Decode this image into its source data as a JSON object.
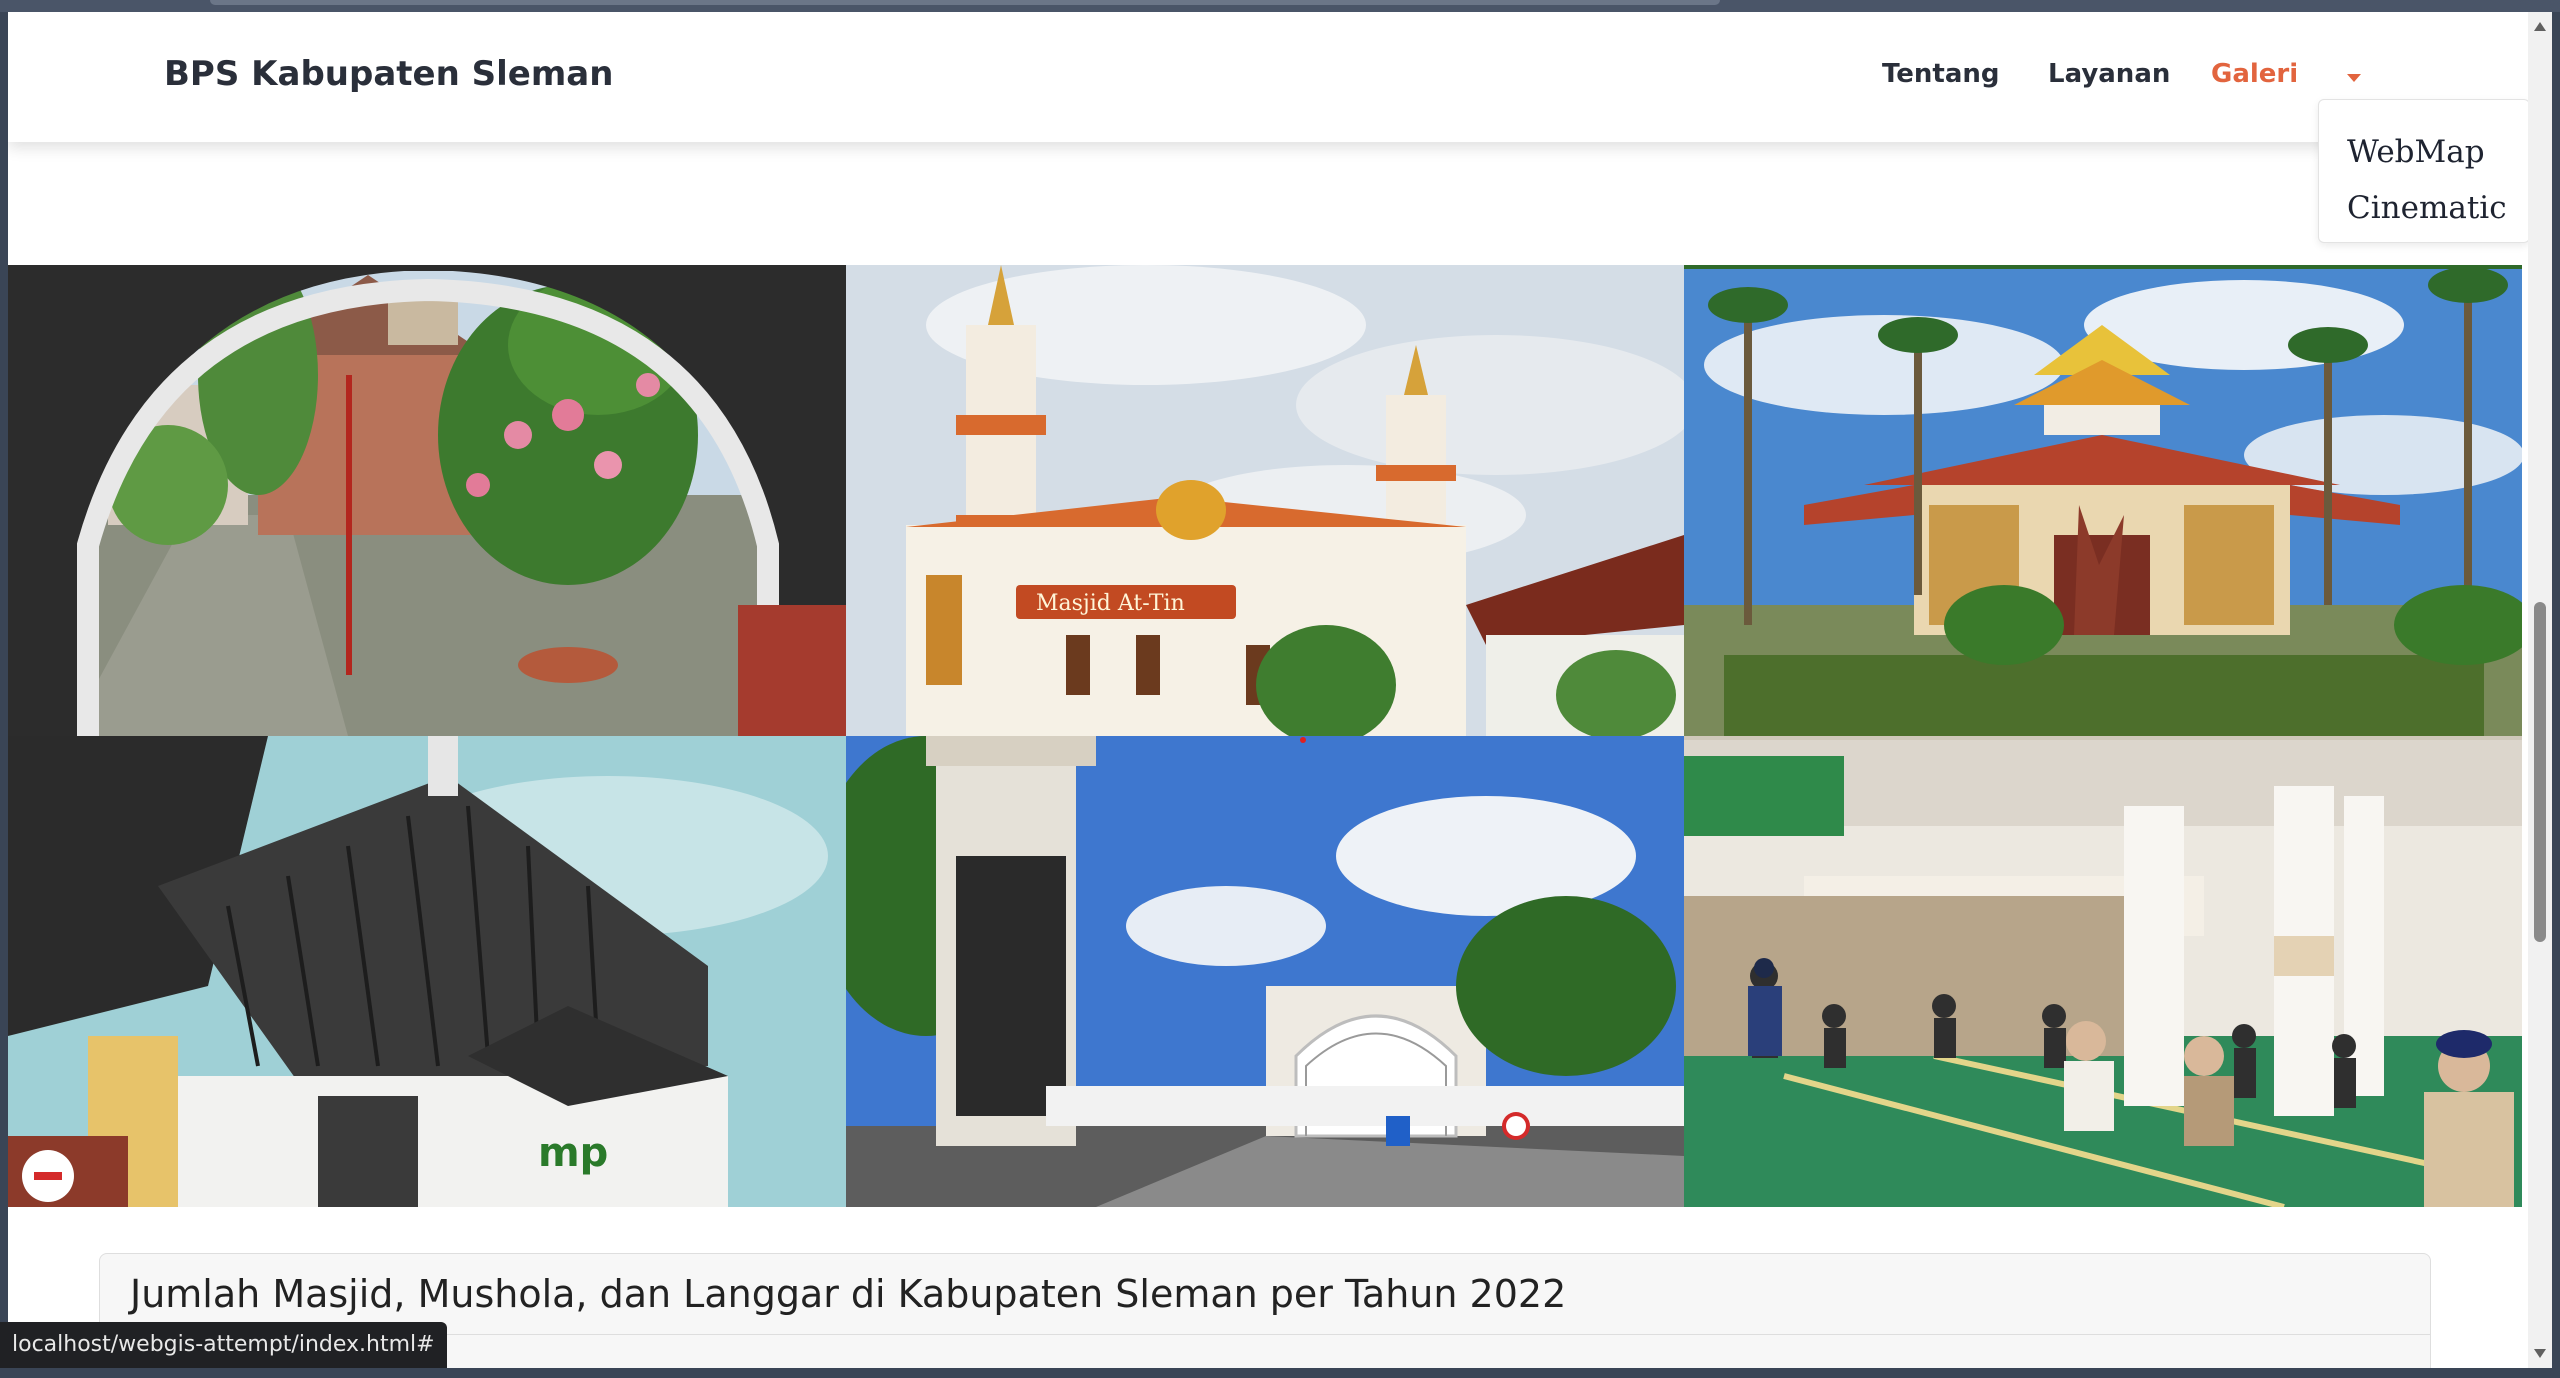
{
  "navbar": {
    "brand": "BPS Kabupaten Sleman",
    "links": [
      "Tentang",
      "Layanan",
      "Galeri"
    ],
    "active_link": "Galeri",
    "accent_color": "#e2643e"
  },
  "dropdown": {
    "items": [
      "WebMap",
      "Cinematic"
    ]
  },
  "gallery": {
    "sign_text": "Masjid At-Tin",
    "logo_text": "mp"
  },
  "card": {
    "title": "Jumlah Masjid, Mushola, dan Langgar di Kabupaten Sleman per Tahun 2022"
  },
  "status_bar": {
    "url": "localhost/webgis-attempt/index.html#"
  }
}
